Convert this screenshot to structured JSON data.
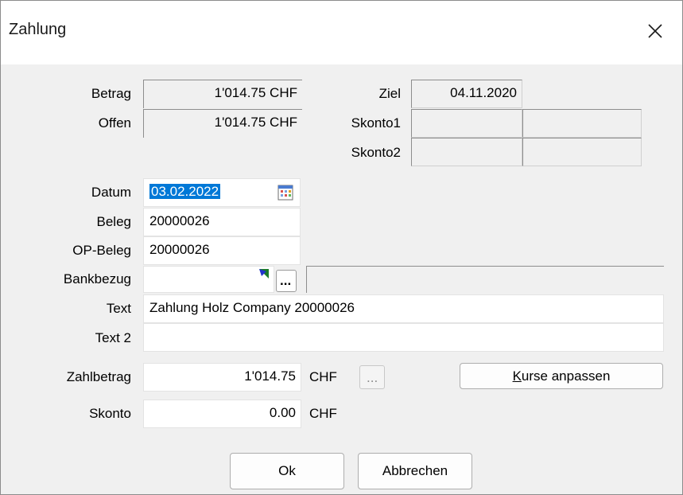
{
  "window": {
    "title": "Zahlung"
  },
  "summary": {
    "betrag_label": "Betrag",
    "betrag_value": "1'014.75 CHF",
    "offen_label": "Offen",
    "offen_value": "1'014.75 CHF",
    "ziel_label": "Ziel",
    "ziel_value": "04.11.2020",
    "skonto1_label": "Skonto1",
    "skonto1_value": "",
    "skonto1_value2": "",
    "skonto2_label": "Skonto2",
    "skonto2_value": "",
    "skonto2_value2": ""
  },
  "form": {
    "datum_label": "Datum",
    "datum_value": "03.02.2022",
    "beleg_label": "Beleg",
    "beleg_value": "20000026",
    "opbeleg_label": "OP-Beleg",
    "opbeleg_value": "20000026",
    "bankbezug_label": "Bankbezug",
    "bankbezug_value": "",
    "bankbezug_button": "...",
    "text_label": "Text",
    "text_value": "Zahlung Holz Company 20000026",
    "text2_label": "Text 2",
    "text2_value": "",
    "zahlbetrag_label": "Zahlbetrag",
    "zahlbetrag_value": "1'014.75",
    "zahlbetrag_currency": "CHF",
    "zahlbetrag_button": "...",
    "skonto_label": "Skonto",
    "skonto_value": "0.00",
    "skonto_currency": "CHF"
  },
  "buttons": {
    "kurse_prefix": "K",
    "kurse_rest": "urse anpassen",
    "ok": "Ok",
    "cancel": "Abbrechen"
  },
  "colors": {
    "selection": "#0078d7",
    "dialog_bg": "#f0f0f0",
    "title_bg": "#ffffff"
  }
}
